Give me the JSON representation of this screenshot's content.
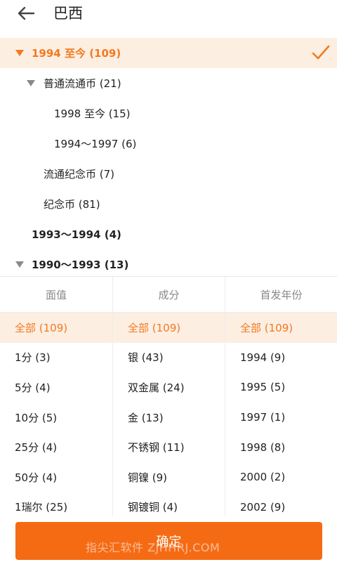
{
  "header": {
    "title": "巴西",
    "back_icon": "arrow-left-icon"
  },
  "tree": {
    "items": [
      {
        "label": "1994 至今 (109)"
      },
      {
        "label": "普通流通币 (21)"
      },
      {
        "label": "1998 至今 (15)"
      },
      {
        "label": "1994～1997 (6)"
      },
      {
        "label": "流通纪念币 (7)"
      },
      {
        "label": "纪念币 (81)"
      },
      {
        "label": "1993～1994 (4)"
      },
      {
        "label": "1990～1993 (13)"
      }
    ]
  },
  "filters": {
    "columns": [
      {
        "header": "面值",
        "options": [
          "全部 (109)",
          "1分 (3)",
          "5分 (4)",
          "10分 (5)",
          "25分 (4)",
          "50分 (4)",
          "1瑞尔 (25)"
        ]
      },
      {
        "header": "成分",
        "options": [
          "全部 (109)",
          "银 (43)",
          "双金属 (24)",
          "金 (13)",
          "不锈钢 (11)",
          "铜镍 (9)",
          "钢镀铜 (4)"
        ]
      },
      {
        "header": "首发年份",
        "options": [
          "全部 (109)",
          "1994 (9)",
          "1995 (5)",
          "1997 (1)",
          "1998 (8)",
          "2000 (2)",
          "2002 (9)"
        ]
      }
    ]
  },
  "confirm_label": "确定",
  "watermark": "指尖汇软件 ZJHHRJ.COM",
  "colors": {
    "accent": "#f07a20",
    "selected_bg": "#fdeee2",
    "button": "#f56b14"
  }
}
